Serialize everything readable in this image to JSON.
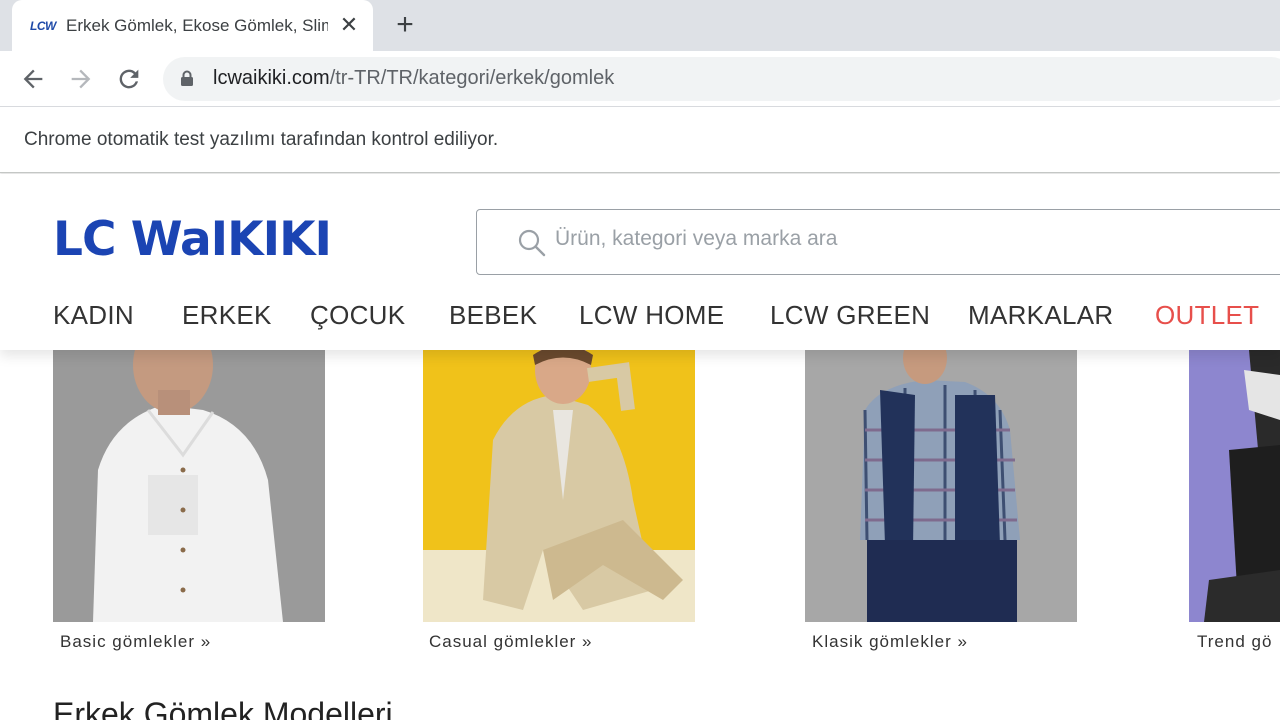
{
  "browser": {
    "tab": {
      "favicon_text": "LCW",
      "title": "Erkek Gömlek, Ekose Gömlek, Slim Fit Gömlek",
      "close_glyph": "✕"
    },
    "new_tab_glyph": "+",
    "url_host": "lcwaikiki.com",
    "url_path": "/tr-TR/TR/kategori/erkek/gomlek",
    "infobar_text": "Chrome otomatik test yazılımı tarafından kontrol ediliyor."
  },
  "site": {
    "logo": "LC WaIKIKI",
    "search_placeholder": "Ürün, kategori veya marka ara",
    "nav": [
      {
        "label": "KADIN"
      },
      {
        "label": "ERKEK"
      },
      {
        "label": "ÇOCUK"
      },
      {
        "label": "BEBEK"
      },
      {
        "label": "LCW HOME"
      },
      {
        "label": "LCW GREEN"
      },
      {
        "label": "MARKALAR"
      },
      {
        "label": "OUTLET"
      }
    ],
    "categories": [
      {
        "label": "Basic gömlekler »"
      },
      {
        "label": "Casual gömlekler »"
      },
      {
        "label": "Klasik gömlekler »"
      },
      {
        "label": "Trend gö"
      }
    ],
    "section_title": "Erkek Gömlek Modelleri"
  },
  "colors": {
    "brand_blue": "#1b44b3",
    "outlet_red": "#e74f4b"
  },
  "icons": [
    "back-arrow-icon",
    "forward-arrow-icon",
    "reload-icon",
    "lock-icon",
    "search-icon",
    "close-icon",
    "plus-icon"
  ]
}
